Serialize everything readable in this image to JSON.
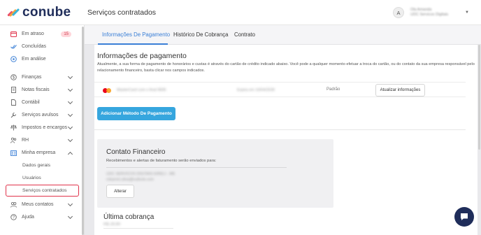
{
  "app": {
    "logo_text": "conube",
    "page_title": "Serviços contratados"
  },
  "user": {
    "avatar_initial": "A",
    "name_line1": "Ola Amanda",
    "name_line2": "UDC Servicos Digitais"
  },
  "sidebar": {
    "items": [
      {
        "label": "Em atraso",
        "badge": "15"
      },
      {
        "label": "Concluídas"
      },
      {
        "label": "Em análise"
      },
      {
        "label": "Finanças"
      },
      {
        "label": "Notas fiscais"
      },
      {
        "label": "Contábil"
      },
      {
        "label": "Serviços avulsos"
      },
      {
        "label": "Impostos e encargos"
      },
      {
        "label": "RH"
      },
      {
        "label": "Minha empresa"
      },
      {
        "label": "Meus contatos"
      },
      {
        "label": "Ajuda"
      }
    ],
    "subitems": [
      {
        "label": "Dados gerais"
      },
      {
        "label": "Usuários"
      },
      {
        "label": "Serviços contratados"
      }
    ]
  },
  "tabs": [
    {
      "label": "Informações De Pagamento"
    },
    {
      "label": "Histórico De Cobrança"
    },
    {
      "label": "Contrato"
    }
  ],
  "payment": {
    "title": "Informações de pagamento",
    "description": "Atualmente, a sua forma de pagamento de honorários e custas é através do cartão de crédito indicado abaixo. Você pode a qualquer momento efetuar a troca do cartão, ou do contato da sua empresa responsável pelo relacionamento financeiro, basta clicar nos campos indicados.",
    "card_name": "MasterCard com o final 9835",
    "card_expiry": "Expira em 10/04/2028",
    "default_label": "Padrão",
    "update_button": "Atualizar informações",
    "add_button": "Adicionar Método De Pagamento"
  },
  "financial_contact": {
    "title": "Contato Financeiro",
    "description": "Recebimentos e alertas de faturamento serão enviados para:",
    "company": "UDC SERVICOS DIGITAIS EIRELI - ME",
    "email": "rokarnm.silva@outlook.com",
    "alter_button": "Alterar"
  },
  "last_charge": {
    "title": "Última cobrança",
    "value": "R$ 29,90"
  },
  "colors": {
    "accent": "#3a7fd6",
    "brand_navy": "#1f2d5a",
    "primary_button": "#36a6de",
    "highlight_border": "#e0334b"
  }
}
